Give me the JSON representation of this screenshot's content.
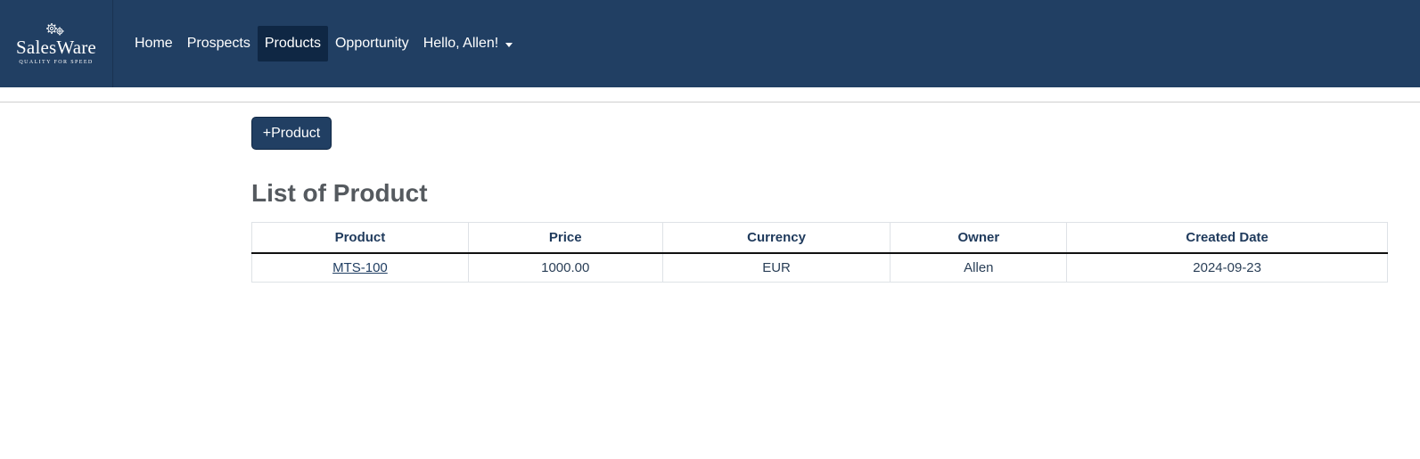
{
  "brand": {
    "name": "SalesWare",
    "tagline": "QUALITY FOR SPEED",
    "icon": "gears-icon"
  },
  "nav": {
    "items": [
      {
        "label": "Home"
      },
      {
        "label": "Prospects"
      },
      {
        "label": "Products",
        "active": true
      },
      {
        "label": "Opportunity"
      }
    ],
    "user_label": "Hello, Allen!"
  },
  "toolbar": {
    "add_product_label": "+Product"
  },
  "page": {
    "title": "List of Product"
  },
  "table": {
    "headers": [
      "Product",
      "Price",
      "Currency",
      "Owner",
      "Created Date"
    ],
    "rows": [
      {
        "product": "MTS-100",
        "price": "1000.00",
        "currency": "EUR",
        "owner": "Allen",
        "created": "2024-09-23"
      }
    ]
  },
  "colors": {
    "navbar": "#213f63",
    "active_nav": "#0f2744",
    "button": "#213f63",
    "title": "#555a5f"
  }
}
